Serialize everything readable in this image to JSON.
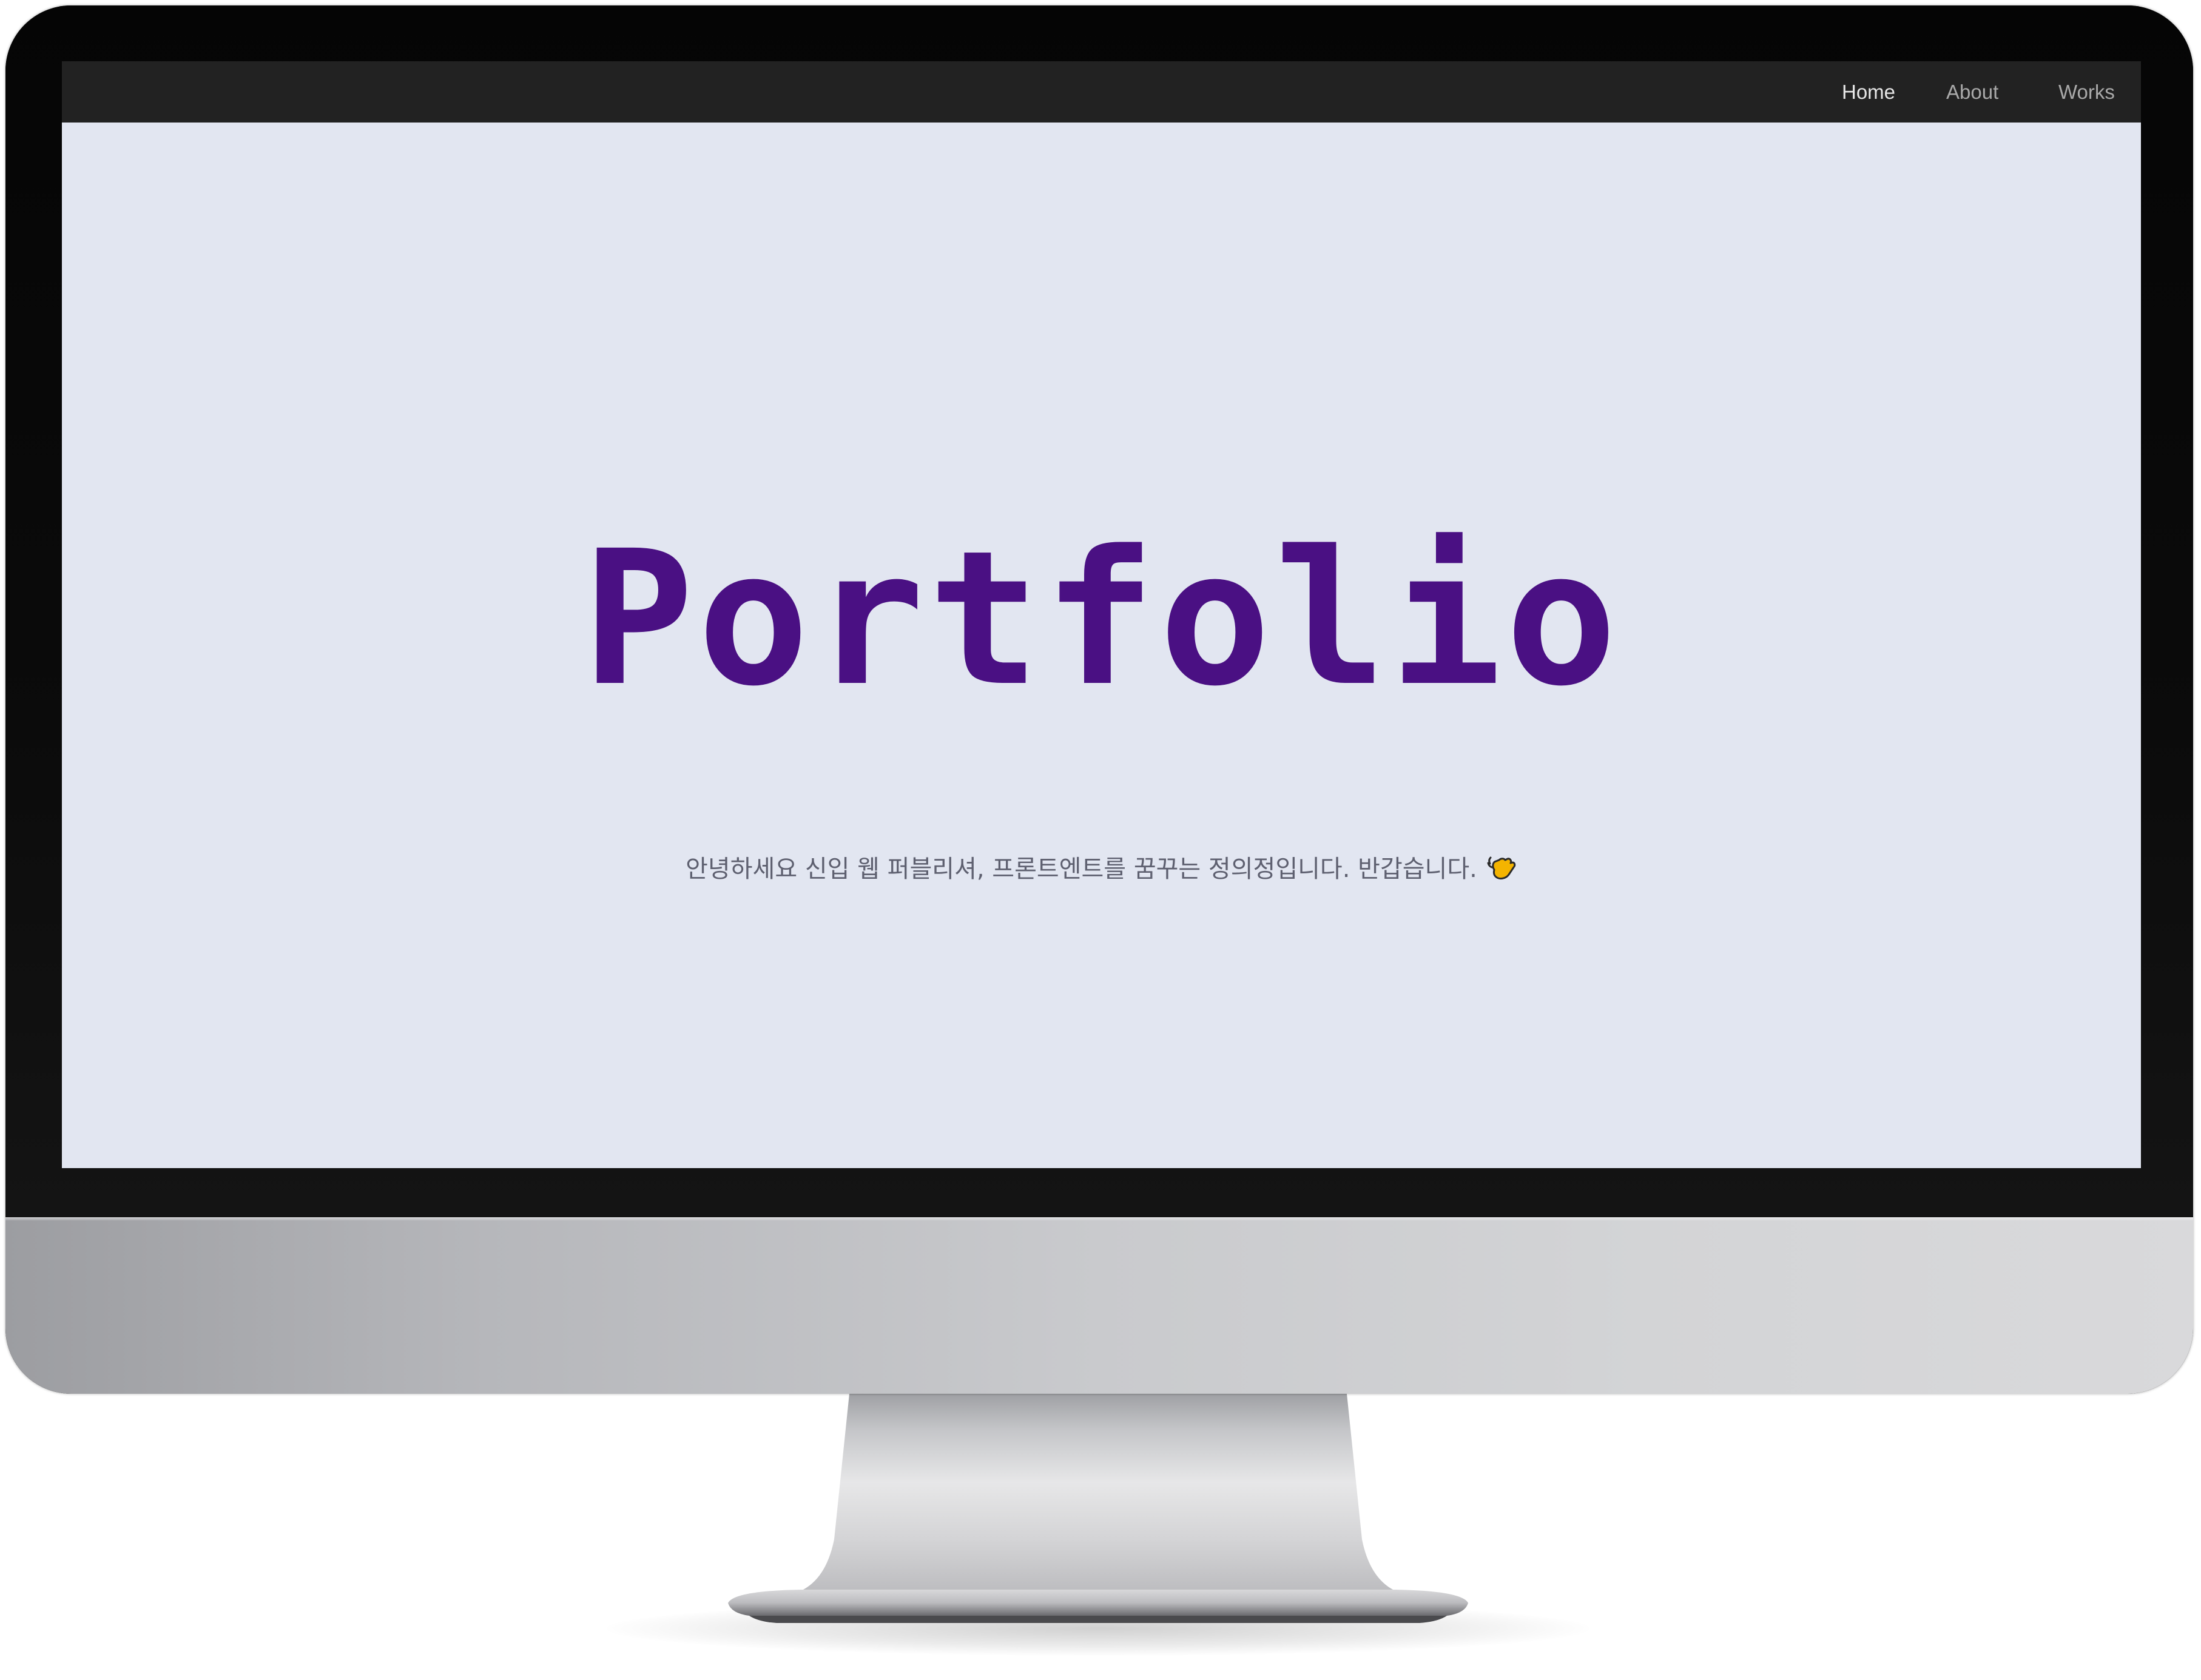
{
  "nav": {
    "items": [
      {
        "label": "Home",
        "active": true
      },
      {
        "label": "About",
        "active": false
      },
      {
        "label": "Works",
        "active": false
      }
    ]
  },
  "hero": {
    "title": "Portfolio",
    "subtitle": "안녕하세요 신입 웹 퍼블리셔, 프론트엔트를 꿈꾸는 정의정입니다. 반갑습니다.",
    "subtitle_icon": "waving-hand-icon"
  },
  "colors": {
    "navbar_bg": "#222222",
    "screen_bg": "#e2e6f1",
    "title_color": "#4a1083",
    "subtitle_color": "#5e6070"
  }
}
